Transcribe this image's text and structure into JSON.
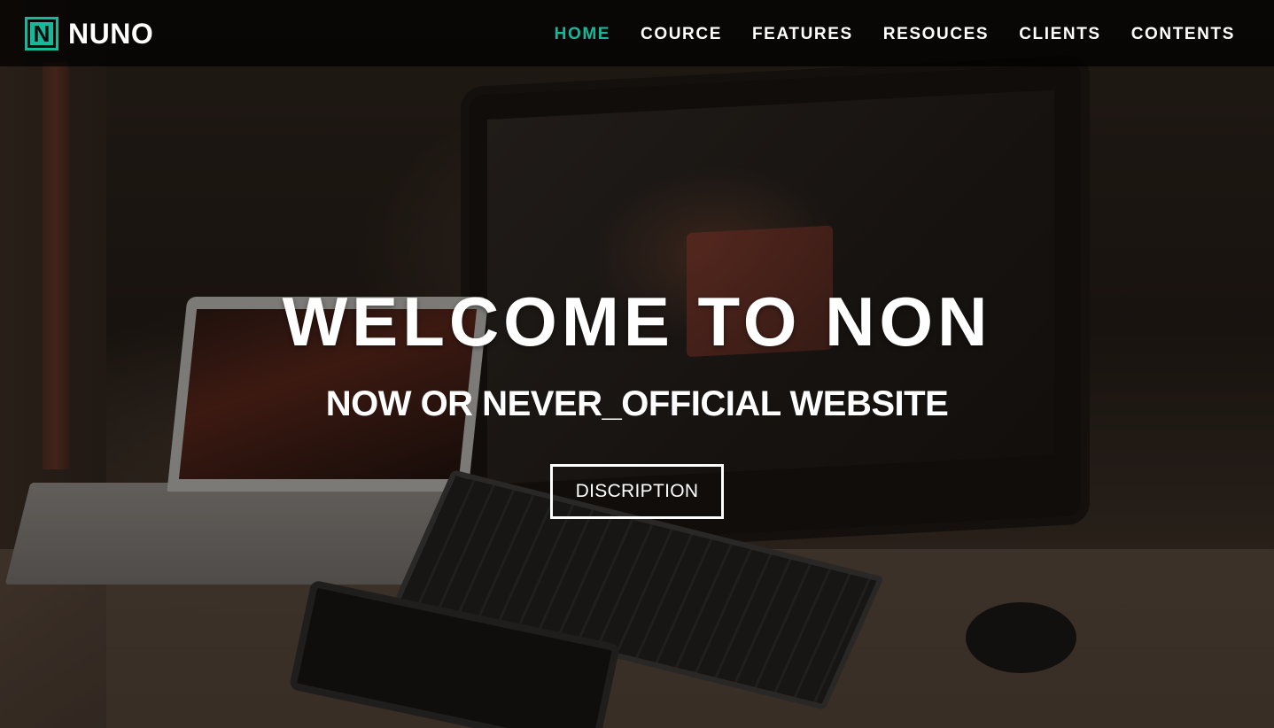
{
  "brand": {
    "logo_letter": "N",
    "name": "NUNO",
    "accent_color": "#17b79a"
  },
  "nav": {
    "items": [
      {
        "label": "HOME",
        "active": true
      },
      {
        "label": "COURCE",
        "active": false
      },
      {
        "label": "FEATURES",
        "active": false
      },
      {
        "label": "RESOUCES",
        "active": false
      },
      {
        "label": "CLIENTS",
        "active": false
      },
      {
        "label": "CONTENTS",
        "active": false
      }
    ]
  },
  "hero": {
    "title": "WELCOME TO NON",
    "subtitle": "NOW OR NEVER_OFFICIAL WEBSITE",
    "button_label": "DISCRIPTION"
  }
}
